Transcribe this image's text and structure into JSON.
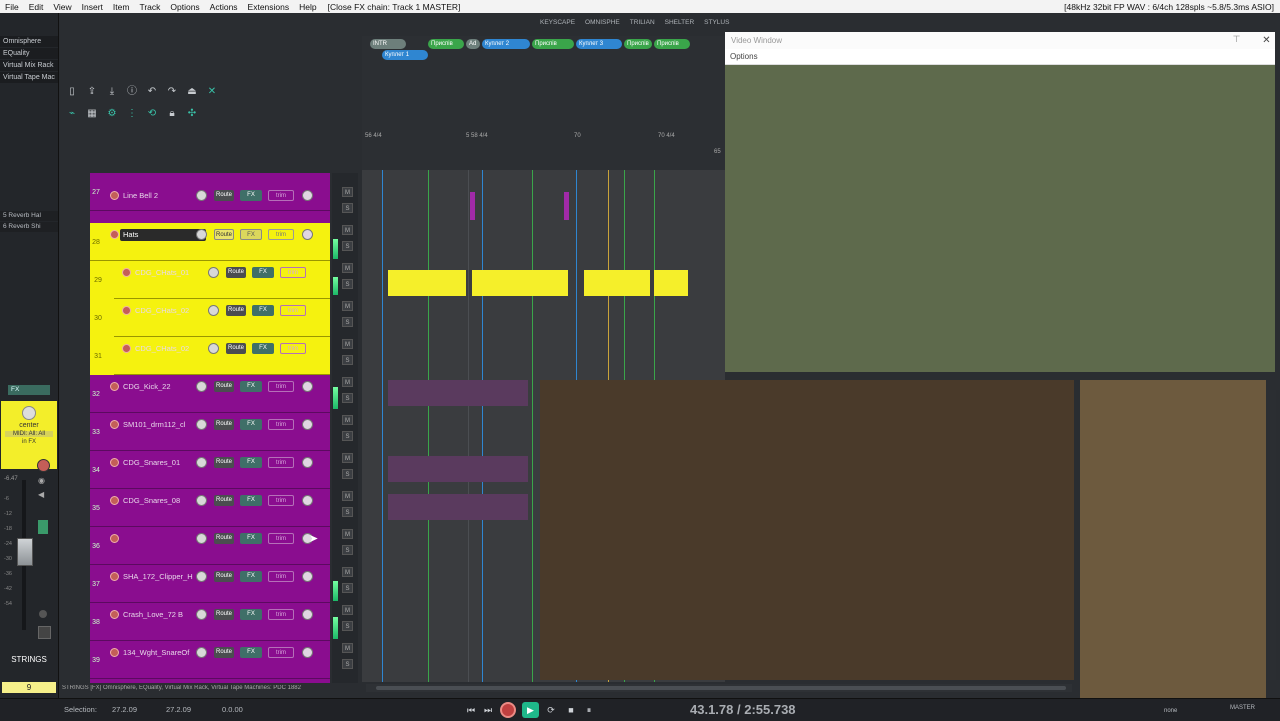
{
  "menubar": {
    "items": [
      "File",
      "Edit",
      "View",
      "Insert",
      "Item",
      "Track",
      "Options",
      "Actions",
      "Extensions",
      "Help"
    ],
    "title": "[Close FX chain: Track 1 MASTER]",
    "status": "[48kHz 32bit FP WAV : 6/4ch 128spls ~5.8/5.3ms ASIO]"
  },
  "vsti_tabs": [
    "KEYSCAPE",
    "OMNISPHE",
    "TRILIAN",
    "SHELTER",
    "STYLUS"
  ],
  "mixer": {
    "fx_list": [
      "Omnisphere",
      "EQuality",
      "Virtual Mix Rack",
      "Virtual Tape Mac"
    ],
    "sends": [
      "5 Reverb Hal",
      "6 Reverb Shi"
    ],
    "fx_badge": "FX",
    "pan_label": "center",
    "routing_label": "MIDI: All: All",
    "in_fx_label": "in FX",
    "db_top": "-6.47",
    "scale": [
      "-6",
      "-12",
      "-18",
      "-24",
      "-30",
      "-36",
      "-42",
      "-54"
    ],
    "track_name": "STRINGS",
    "track_number": "9"
  },
  "regions": [
    {
      "label": "INTR",
      "color": "#6d7f7b"
    },
    {
      "label": "Приспів",
      "color": "#3aa54a"
    },
    {
      "label": "Куплет 2",
      "color": "#2f86d1"
    },
    {
      "label": "Приспів",
      "color": "#3aa54a"
    },
    {
      "label": "Куплет 3",
      "color": "#2f86d1"
    },
    {
      "label": "Приспів",
      "color": "#3aa54a"
    },
    {
      "label": "Приспів",
      "color": "#3aa54a"
    },
    {
      "label": "Куплет 1",
      "color": "#2f86d1"
    },
    {
      "label": "Ad",
      "color": "#6d7f7b"
    }
  ],
  "ruler": {
    "marks": [
      "56 4/4",
      "5 58 4/4",
      "70",
      "70 4/4",
      "65"
    ]
  },
  "tracks": [
    {
      "num": "27",
      "name": "Line Bell 2",
      "style": "purple"
    },
    {
      "num": "28",
      "name": "Hats",
      "style": "yellow"
    },
    {
      "num": "29",
      "name": "CDG_CHats_01",
      "style": "child"
    },
    {
      "num": "30",
      "name": "CDG_CHats_02",
      "style": "child"
    },
    {
      "num": "31",
      "name": "CDG_CHats_02",
      "style": "child"
    },
    {
      "num": "32",
      "name": "CDG_Kick_22",
      "style": "purple"
    },
    {
      "num": "33",
      "name": "SM101_drm112_cl",
      "style": "purple"
    },
    {
      "num": "34",
      "name": "CDG_Snares_01",
      "style": "purple"
    },
    {
      "num": "35",
      "name": "CDG_Snares_08",
      "style": "purple"
    },
    {
      "num": "36",
      "name": "",
      "style": "purple"
    },
    {
      "num": "37",
      "name": "SHA_172_Clipper_H",
      "style": "purple"
    },
    {
      "num": "38",
      "name": "Crash_Love_72 B",
      "style": "purple"
    },
    {
      "num": "39",
      "name": "134_Wght_SnareOf",
      "style": "purple"
    }
  ],
  "track_buttons": {
    "route": "Route",
    "fx": "FX",
    "trim": "trim",
    "mute": "M",
    "solo": "S"
  },
  "video": {
    "title": "Video Window",
    "options": "Options"
  },
  "transport": {
    "timecode": "43.1.78 / 2:55.738",
    "selection_label": "Selection:",
    "sel_start": "27.2.09",
    "sel_end": "27.2.09",
    "sel_len": "0.0.00",
    "status": "STRINGS [FX] Omnisphere, EQuality, Virtual Mix Rack, Virtual Tape Machines: PDC 1882",
    "right_label": "MASTER",
    "right_vol": "none"
  },
  "colors": {
    "purple_track": "#8a0d8f",
    "yellow_track": "#f5f20f",
    "accent": "#39c2a8"
  }
}
